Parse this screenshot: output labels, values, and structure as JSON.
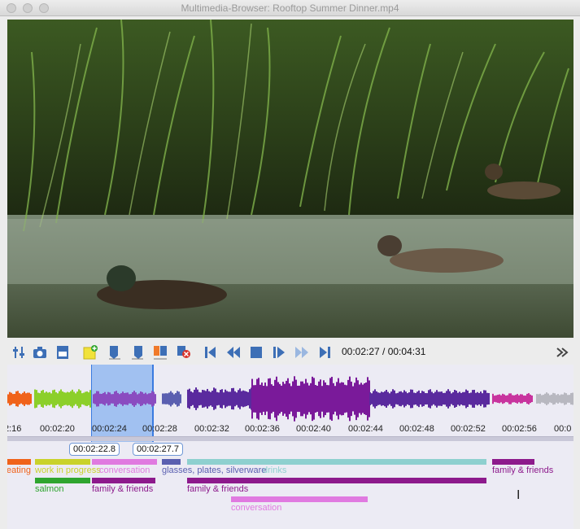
{
  "window": {
    "title": "Multimedia-Browser:  Rooftop Summer Dinner.mp4"
  },
  "video": {
    "alt": "ducks swimming in a pond with reeds"
  },
  "toolbar": {
    "icons": [
      "sliders-icon",
      "camera-icon",
      "frame-icon",
      "add-note-icon",
      "marker-in-icon",
      "marker-out-icon",
      "marker-multi-icon",
      "marker-remove-icon",
      "skip-start-icon",
      "rewind-icon",
      "stop-icon",
      "play-icon",
      "fast-forward-icon",
      "skip-end-icon",
      "expand-icon"
    ],
    "time_display": "00:02:27 / 00:04:31"
  },
  "timeline": {
    "ticks": [
      "2:16",
      "00:02:20",
      "00:02:24",
      "00:02:28",
      "00:02:32",
      "00:02:36",
      "00:02:40",
      "00:02:44",
      "00:02:48",
      "00:02:52",
      "00:02:56",
      "00:0"
    ],
    "selection_start": "00:02:22.8",
    "selection_end": "00:02:27.7",
    "zoom_icons": [
      "zoom-out-icon",
      "zoom-100-icon",
      "fit-width-icon",
      "zoom-in-icon",
      "filter-icon"
    ],
    "annotations": {
      "eating": "eating",
      "work_in_progress": "work in progress",
      "conversation_1": "conversation",
      "glasses": "glasses, plates, silverware",
      "drinks": "drinks",
      "family_friends_right": "family & friends",
      "salmon": "salmon",
      "family_friends_1": "family & friends",
      "family_friends_2": "family & friends",
      "conversation_2": "conversation"
    }
  },
  "colors": {
    "eating": "#f0621a",
    "work_in_progress": "#c9d22a",
    "conversation": "#e07ae0",
    "family": "#8d1a8c",
    "glasses": "#5a5fb0",
    "drinks": "#8ed0cf",
    "salmon": "#2fa52f"
  }
}
